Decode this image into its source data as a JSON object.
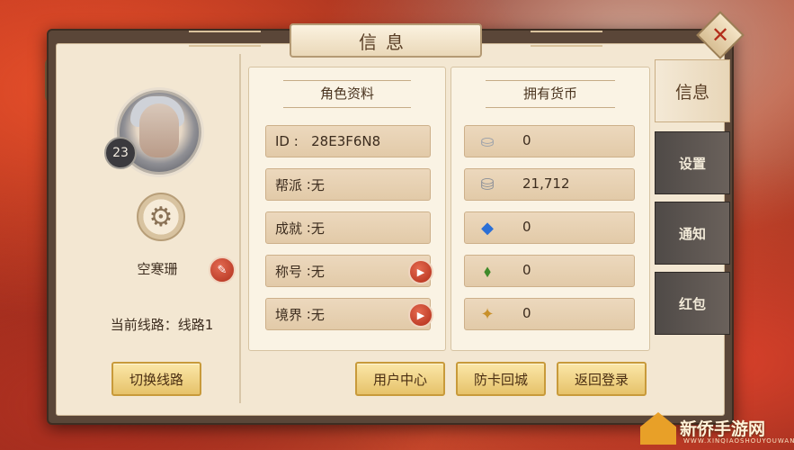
{
  "window": {
    "title": "信息"
  },
  "player": {
    "level": "23",
    "name": "空寒珊",
    "current_line": "当前线路：线路1"
  },
  "buttons": {
    "switch_line": "切换线路",
    "user_center": "用户中心",
    "anti_stuck": "防卡回城",
    "back_login": "返回登录"
  },
  "profile": {
    "title": "角色资料",
    "fields": [
      {
        "label": "ID",
        "sep": " :   ",
        "value": "28E3F6N8",
        "has_arrow": false
      },
      {
        "label": "帮派",
        "sep": " :",
        "value": "无",
        "has_arrow": false
      },
      {
        "label": "成就",
        "sep": " :",
        "value": "无",
        "has_arrow": false
      },
      {
        "label": "称号",
        "sep": " :",
        "value": "无",
        "has_arrow": true
      },
      {
        "label": "境界",
        "sep": " :",
        "value": "无",
        "has_arrow": true
      }
    ]
  },
  "currency": {
    "title": "拥有货币",
    "items": [
      {
        "icon": "silver-ingot-icon",
        "value": "0"
      },
      {
        "icon": "bound-silver-icon",
        "value": "21,712"
      },
      {
        "icon": "blue-diamond-icon",
        "value": "0"
      },
      {
        "icon": "green-jade-icon",
        "value": "0"
      },
      {
        "icon": "gold-token-icon",
        "value": "0"
      }
    ]
  },
  "tabs": [
    {
      "label": "信息",
      "active": true
    },
    {
      "label": "设置",
      "active": false
    },
    {
      "label": "通知",
      "active": false
    },
    {
      "label": "红包",
      "active": false
    }
  ],
  "watermark": {
    "text": "新侨手游网",
    "sub": "WWW.XINQIAOSHOUYOUWANG"
  },
  "colors": {
    "panel_bg": "#f3e7d2",
    "button_gold": "#e6c26a",
    "accent_red": "#b32d1b"
  }
}
